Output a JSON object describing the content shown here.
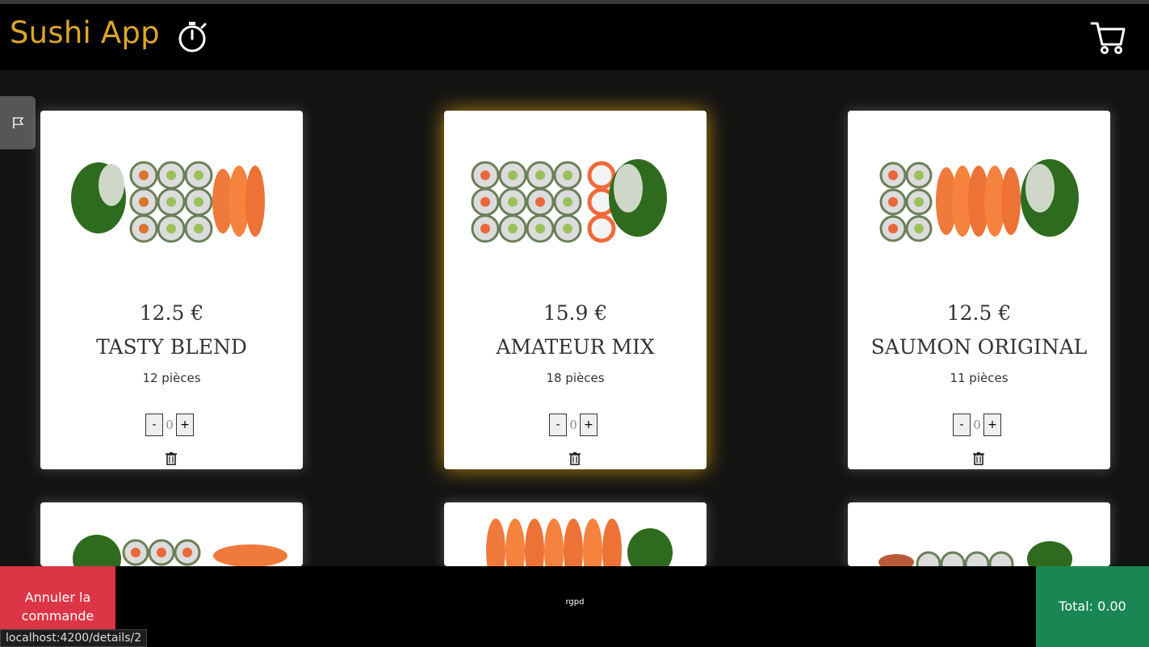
{
  "app": {
    "title": "Sushi App"
  },
  "header": {
    "timer_icon": "stopwatch-icon",
    "cart_icon": "cart-icon"
  },
  "side_tab": {
    "icon": "flag-icon"
  },
  "products": [
    {
      "price": "12.5 €",
      "name": "TASTY BLEND",
      "pieces": "12 pièces",
      "qty": "0"
    },
    {
      "price": "15.9 €",
      "name": "AMATEUR MIX",
      "pieces": "18 pièces",
      "qty": "0"
    },
    {
      "price": "12.5 €",
      "name": "SAUMON ORIGINAL",
      "pieces": "11 pièces",
      "qty": "0"
    },
    {
      "price": "",
      "name": "",
      "pieces": "",
      "qty": ""
    },
    {
      "price": "",
      "name": "",
      "pieces": "",
      "qty": ""
    },
    {
      "price": "",
      "name": "",
      "pieces": "",
      "qty": ""
    }
  ],
  "controls": {
    "minus": "-",
    "plus": "+"
  },
  "footer": {
    "cancel_label": "Annuler la commande",
    "rgpd": "rgpd",
    "total_label": "Total: 0.00"
  },
  "status_bar": "localhost:4200/details/2",
  "colors": {
    "brand": "#dca52b",
    "cancel": "#dc3545",
    "total": "#198754",
    "highlight_glow": "#ebaf14"
  }
}
